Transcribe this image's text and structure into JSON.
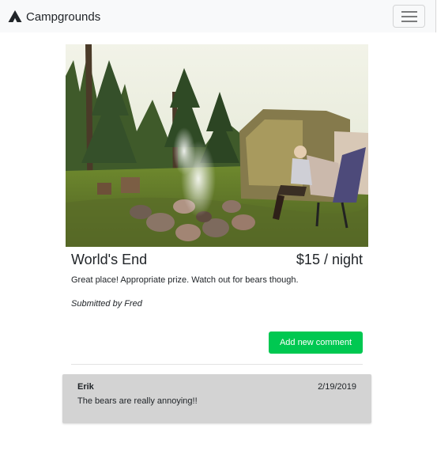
{
  "navbar": {
    "brand_icon": "campground-tent-icon",
    "brand": "Campgrounds",
    "menu_icon": "hamburger-menu-icon"
  },
  "campground": {
    "image_alt": "campground photo with campfire and tent",
    "name": "World's End",
    "price": "$15 / night",
    "description": "Great place! Appropriate prize. Watch out for bears though.",
    "submitted_by": "Submitted by Fred"
  },
  "actions": {
    "add_comment": "Add new comment"
  },
  "comments": [
    {
      "author": "Erik",
      "date": "2/19/2019",
      "text": "The bears are really annoying!!"
    }
  ],
  "colors": {
    "navbar_bg": "#f8f9fa",
    "button_green": "#00c851",
    "comment_bg": "#d3d3d3"
  }
}
